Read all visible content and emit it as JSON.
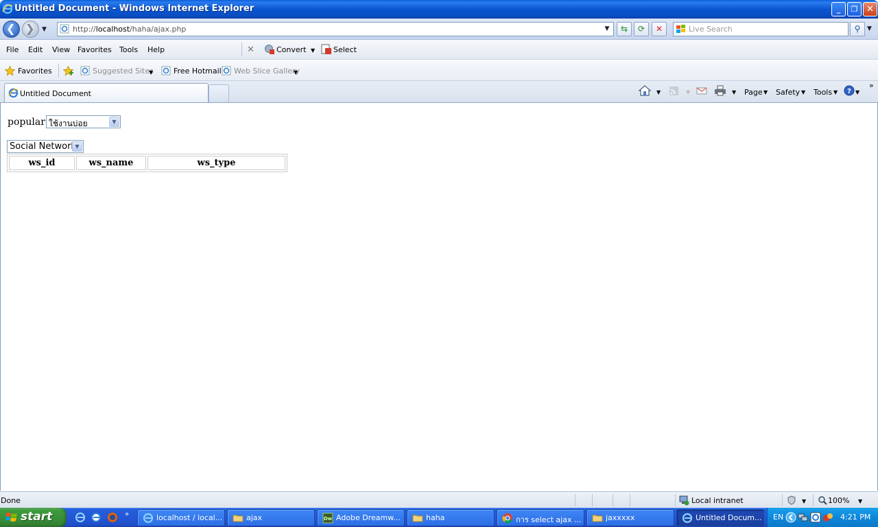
{
  "window": {
    "title": "Untitled Document - Windows Internet Explorer",
    "minimize": "_",
    "maximize": "❐",
    "close": "✕"
  },
  "nav": {
    "back": "❮",
    "forward": "❯",
    "url_prefix": "http://",
    "url_host": "localhost",
    "url_path": "/haha/ajax.php",
    "search_placeholder": "Live Search"
  },
  "menu": {
    "items": [
      "File",
      "Edit",
      "View",
      "Favorites",
      "Tools",
      "Help"
    ],
    "convert": "Convert",
    "select": "Select"
  },
  "favorites": {
    "label": "Favorites",
    "suggested": "Suggested Sites",
    "hotmail": "Free Hotmail",
    "webslice": "Web Slice Gallery"
  },
  "tab": {
    "title": "Untitled Document"
  },
  "commands": {
    "page": "Page",
    "safety": "Safety",
    "tools": "Tools"
  },
  "content": {
    "popular_label": "popular :",
    "popular_value": "ใช้งานบ่อย",
    "category_value": "Social Network",
    "table_headers": [
      "ws_id",
      "ws_name",
      "ws_type"
    ]
  },
  "status": {
    "text": "Done",
    "zone": "Local intranet",
    "zoom": "100%"
  },
  "taskbar": {
    "start": "start",
    "tasks": [
      {
        "label": "localhost / local...",
        "icon": "ie-icon"
      },
      {
        "label": "ajax",
        "icon": "folder-icon"
      },
      {
        "label": "Adobe Dreamw...",
        "icon": "dreamweaver-icon"
      },
      {
        "label": "haha",
        "icon": "folder-icon"
      },
      {
        "label": "การ select ajax ...",
        "icon": "chrome-icon"
      },
      {
        "label": "jaxxxxx",
        "icon": "folder-icon"
      },
      {
        "label": "Untitled Docum...",
        "icon": "ie-icon"
      }
    ],
    "lang": "EN",
    "clock": "4:21 PM"
  },
  "colors": {
    "titlebar": "#0a57d0",
    "taskbar": "#245edb",
    "start": "#388e38",
    "tray": "#0f87d9"
  }
}
